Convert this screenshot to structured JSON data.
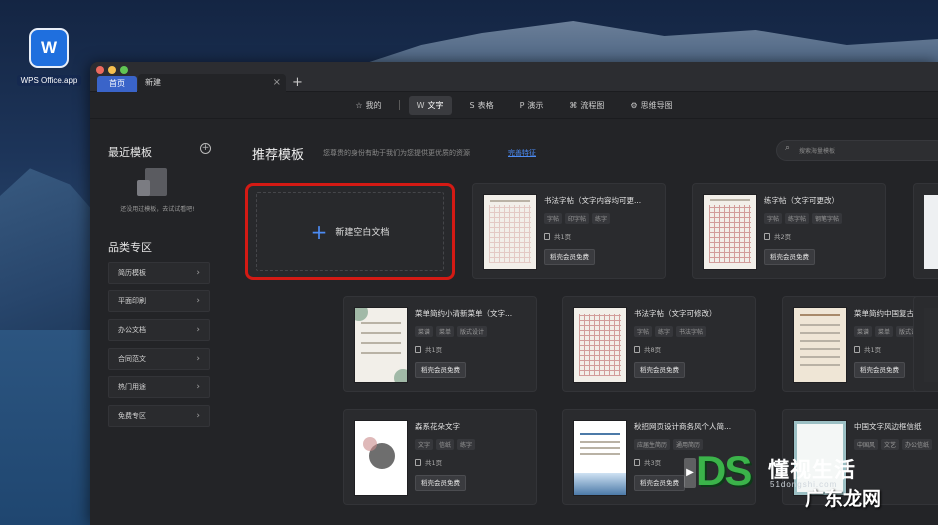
{
  "desktop": {
    "app_icon_glyph": "W",
    "app_label": "WPS Office.app"
  },
  "window": {
    "tabs": {
      "home": "首页",
      "new": "新建",
      "close": "×",
      "add": "+"
    },
    "types": [
      {
        "icon": "star-icon",
        "glyph": "☆",
        "label": "我的"
      },
      {
        "icon": "writer-icon",
        "glyph": "W",
        "label": "文字"
      },
      {
        "icon": "sheet-icon",
        "glyph": "S",
        "label": "表格"
      },
      {
        "icon": "presentation-icon",
        "glyph": "P",
        "label": "演示"
      },
      {
        "icon": "flowchart-icon",
        "glyph": "⌘",
        "label": "流程图"
      },
      {
        "icon": "mindmap-icon",
        "glyph": "⚙",
        "label": "思维导图"
      }
    ],
    "active_type": "文字"
  },
  "sidebar": {
    "recent_title": "最近模板",
    "empty_text": "还没用过模板，去试试看吧!",
    "category_title": "品类专区",
    "categories": [
      "简历模板",
      "平面印刷",
      "办公文档",
      "合同范文",
      "热门用途",
      "免费专区"
    ]
  },
  "main": {
    "title": "推荐模板",
    "subtitle": "您尊贵的身份有助于我们为您提供更优质的资源",
    "link": "完善特征",
    "search_placeholder": "搜索海量模板",
    "new_blank_label": "新建空白文档",
    "cards": [
      {
        "title": "书法字帖（文字内容均可更...",
        "tags": [
          "字帖",
          "印字帖",
          "练字"
        ],
        "pages": "共1页",
        "button": "稻壳会员免费"
      },
      {
        "title": "练字帖（文字可更改）",
        "tags": [
          "字帖",
          "练字帖",
          "钢笔字帖"
        ],
        "pages": "共2页",
        "button": "稻壳会员免费"
      },
      {
        "title": "菜单简约小清新菜单（文字...",
        "tags": [
          "菜谱",
          "菜单",
          "版式设计"
        ],
        "pages": "共1页",
        "button": "稻壳会员免费"
      },
      {
        "title": "书法字帖（文字可修改）",
        "tags": [
          "字帖",
          "练字",
          "书法字帖"
        ],
        "pages": "共8页",
        "button": "稻壳会员免费"
      },
      {
        "title": "菜单简约中国复古风菜单（...",
        "tags": [
          "菜谱",
          "菜单",
          "版式设计"
        ],
        "pages": "共1页",
        "button": "稻壳会员免费"
      },
      {
        "title": "森系花朵文字",
        "tags": [
          "文字",
          "信纸",
          "练字"
        ],
        "pages": "共1页",
        "button": "稻壳会员免费"
      },
      {
        "title": "秋招网页设计商务风个人简...",
        "tags": [
          "应届生简历",
          "通用简历"
        ],
        "pages": "共3页",
        "button": "稻壳会员免费"
      },
      {
        "title": "中国文字风边框信纸",
        "tags": [
          "中国风",
          "文艺",
          "办公信纸"
        ],
        "pages": "",
        "button": ""
      }
    ]
  },
  "watermark": {
    "logo": "DS",
    "brand": "懂视生活",
    "url": "51dongshi.com",
    "site": "广东龙网"
  }
}
